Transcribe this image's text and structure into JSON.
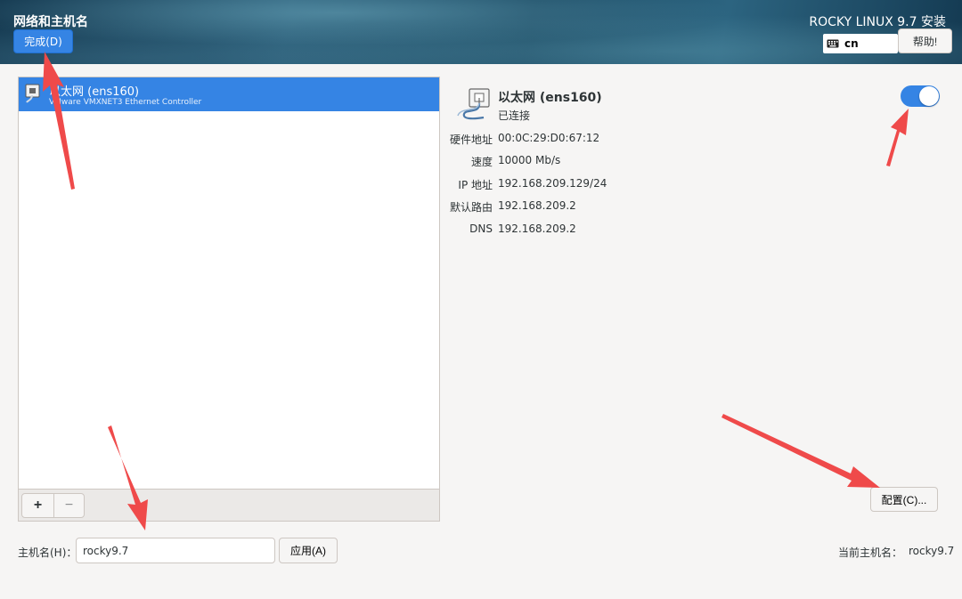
{
  "header": {
    "title": "网络和主机名",
    "done_label": "完成(D)",
    "product": "ROCKY LINUX 9.7 安装",
    "keyboard_layout": "cn",
    "help_label": "帮助!"
  },
  "device_list": {
    "items": [
      {
        "name": "以太网 (ens160)",
        "description": "VMware VMXNET3 Ethernet Controller",
        "selected": true
      }
    ],
    "add_label": "+",
    "remove_label": "−"
  },
  "details": {
    "name": "以太网 (ens160)",
    "status": "已连接",
    "enabled": true,
    "properties": [
      {
        "label": "硬件地址",
        "value": "00:0C:29:D0:67:12"
      },
      {
        "label": "速度",
        "value": "10000 Mb/s"
      },
      {
        "label": "IP 地址",
        "value": "192.168.209.129/24"
      },
      {
        "label": "默认路由",
        "value": "192.168.209.2"
      },
      {
        "label": "DNS",
        "value": "192.168.209.2"
      }
    ],
    "config_label": "配置(C)..."
  },
  "hostname": {
    "label": "主机名(H)：",
    "value": "rocky9.7",
    "apply_label": "应用(A)",
    "current_label": "当前主机名：",
    "current_value": "rocky9.7"
  },
  "colors": {
    "accent": "#3584e4",
    "annotation": "#ef4a4a"
  }
}
